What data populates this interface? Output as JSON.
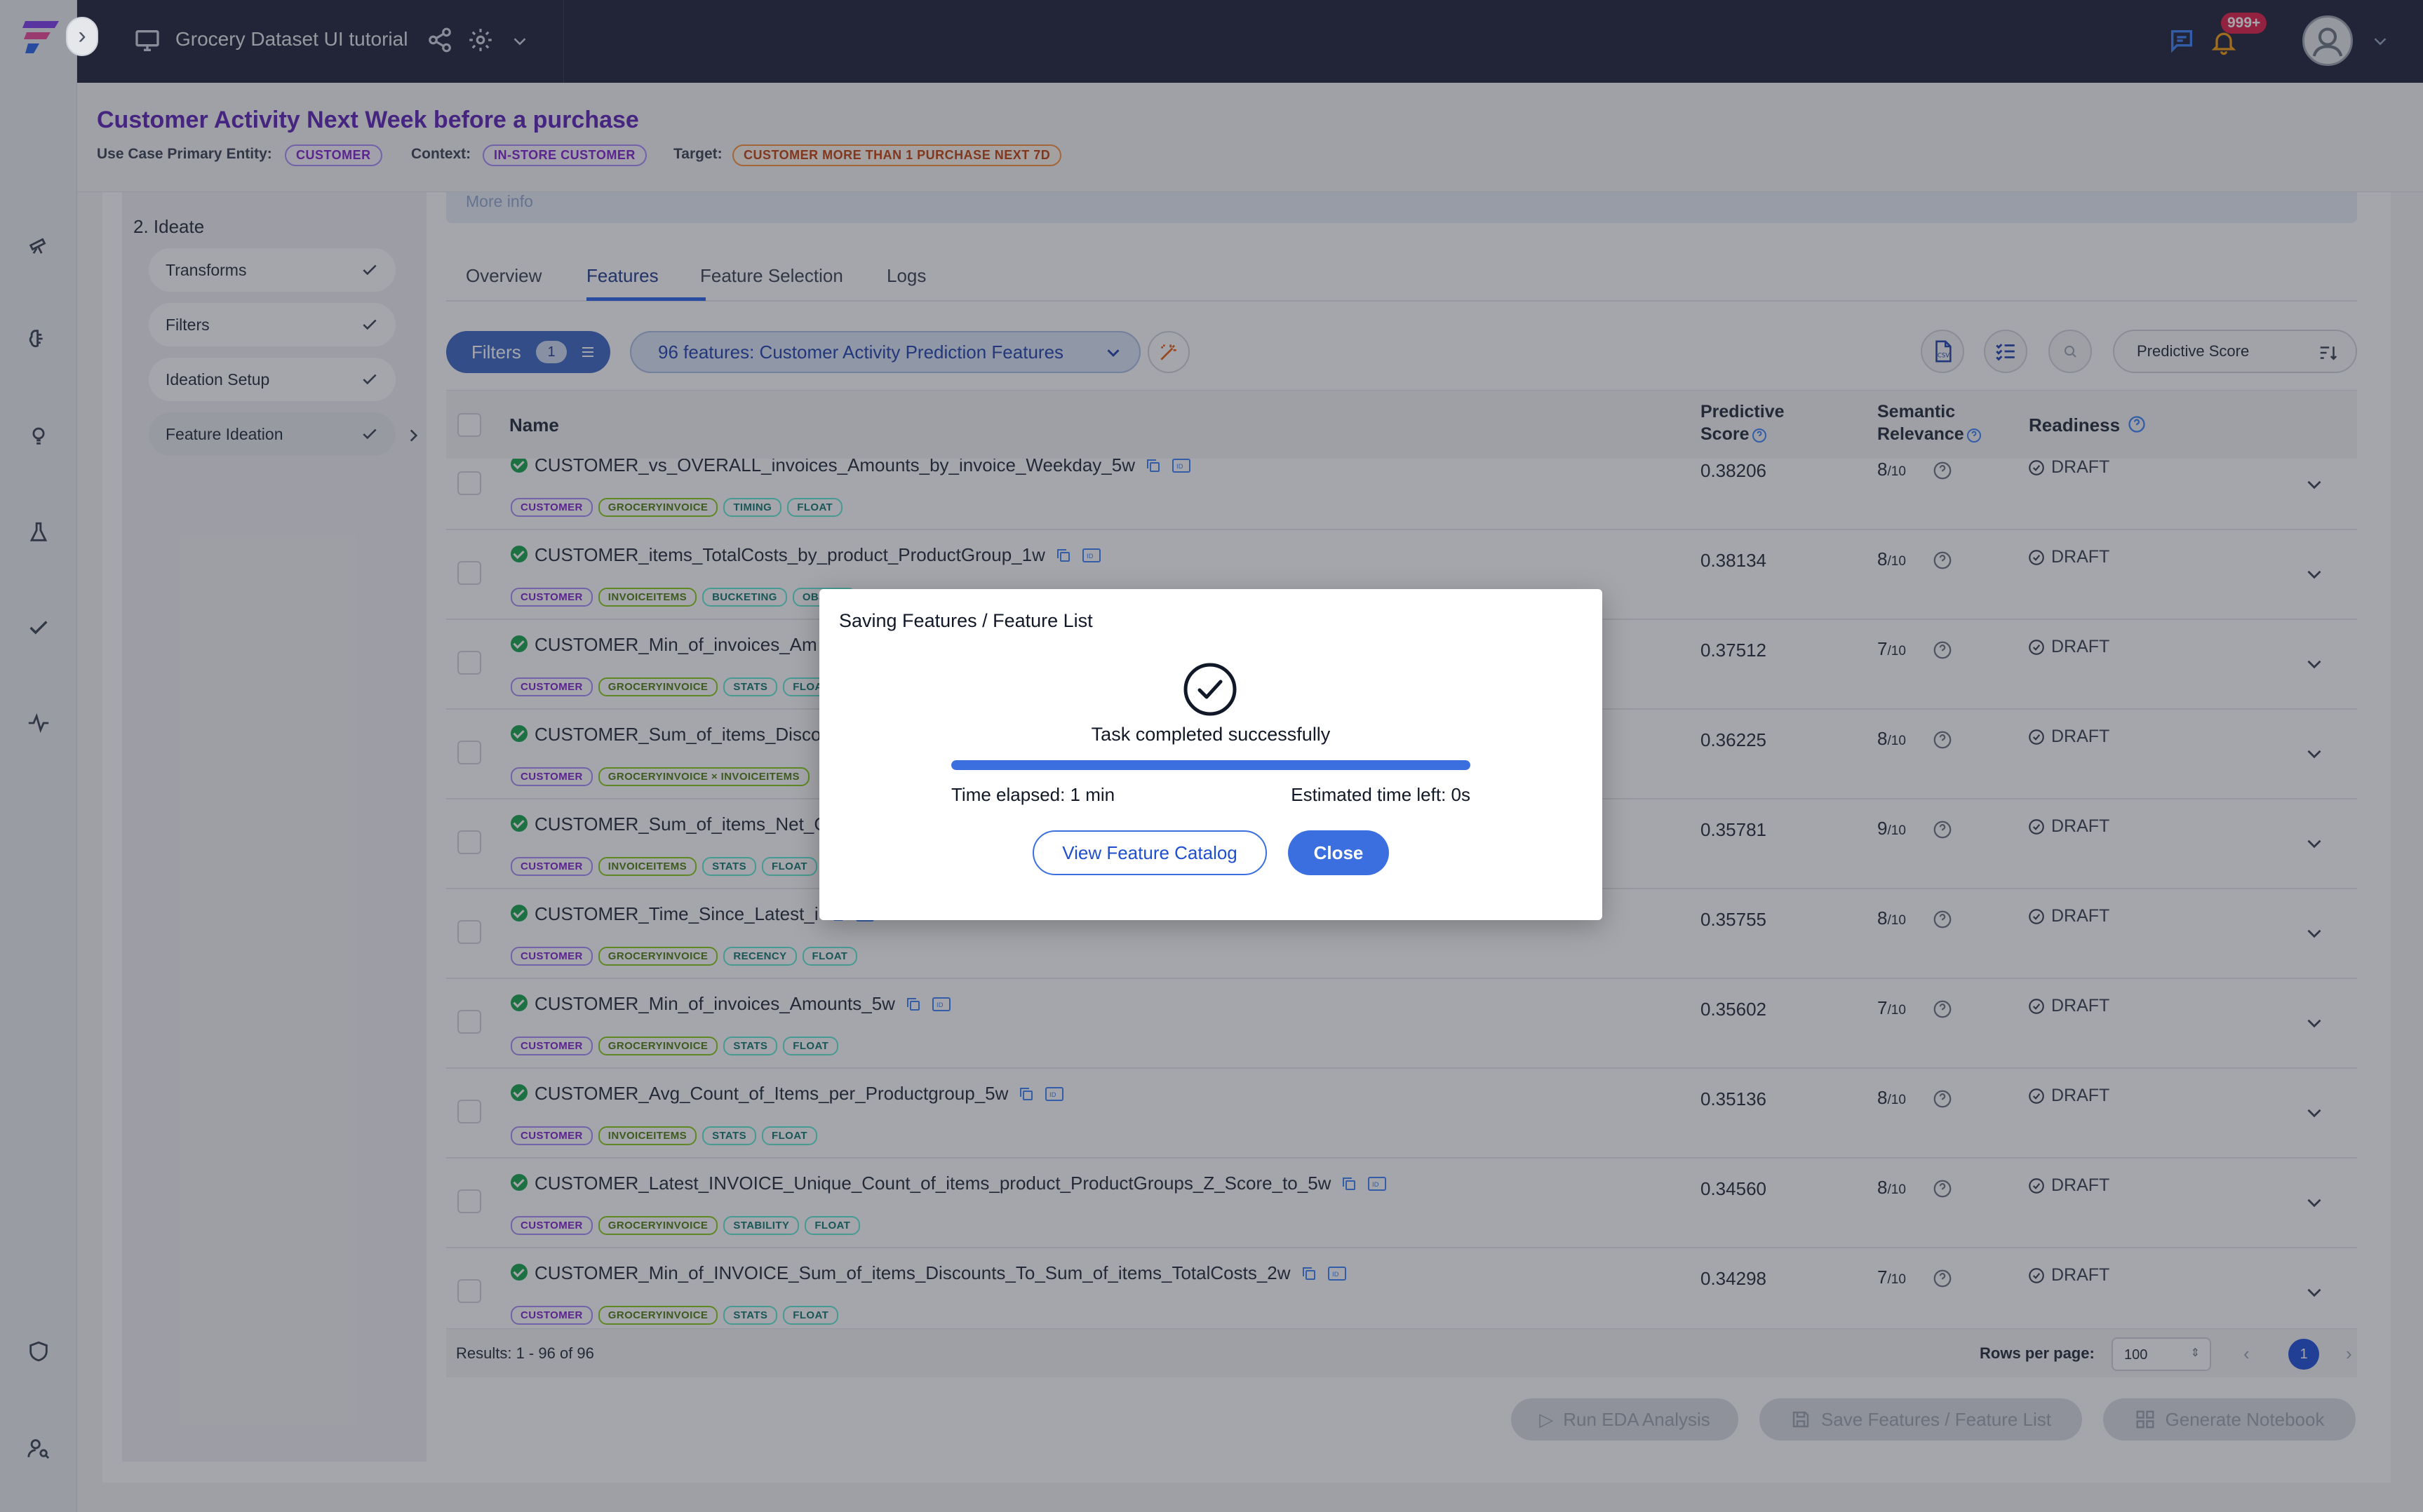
{
  "app": {
    "title": "Grocery Dataset UI tutorial",
    "notification_count": "999+"
  },
  "header": {
    "title": "Customer Activity Next Week before a purchase",
    "entity_label": "Use Case Primary Entity:",
    "entity_value": "CUSTOMER",
    "context_label": "Context:",
    "context_value": "IN-STORE CUSTOMER",
    "target_label": "Target:",
    "target_value": "CUSTOMER MORE THAN 1 PURCHASE NEXT 7D"
  },
  "stepper": {
    "section": "2. Ideate",
    "more_info": "More info",
    "items": [
      {
        "label": "Transforms"
      },
      {
        "label": "Filters"
      },
      {
        "label": "Ideation Setup"
      },
      {
        "label": "Feature Ideation"
      }
    ]
  },
  "tabs": [
    "Overview",
    "Features",
    "Feature Selection",
    "Logs"
  ],
  "toolbar": {
    "filters_label": "Filters",
    "filters_count": "1",
    "feature_list_label": "96 features: Customer Activity Prediction Features",
    "sort_label": "Predictive Score"
  },
  "table": {
    "col_name": "Name",
    "col_score_1": "Predictive",
    "col_score_2": "Score",
    "col_rel_1": "Semantic",
    "col_rel_2": "Relevance",
    "col_ready": "Readiness",
    "rows": [
      {
        "name": "CUSTOMER_vs_OVERALL_invoices_Amounts_by_invoice_Weekday_5w",
        "tags": [
          "CUSTOMER",
          "GROCERYINVOICE",
          "TIMING",
          "FLOAT"
        ],
        "score": "0.38206",
        "rel": "8",
        "ready": "DRAFT"
      },
      {
        "name": "CUSTOMER_items_TotalCosts_by_product_ProductGroup_1w",
        "tags": [
          "CUSTOMER",
          "INVOICEITEMS",
          "BUCKETING",
          "OBJECT"
        ],
        "score": "0.38134",
        "rel": "8",
        "ready": "DRAFT"
      },
      {
        "name": "CUSTOMER_Min_of_invoices_Am",
        "tags": [
          "CUSTOMER",
          "GROCERYINVOICE",
          "STATS",
          "FLOAT"
        ],
        "score": "0.37512",
        "rel": "7",
        "ready": "DRAFT"
      },
      {
        "name": "CUSTOMER_Sum_of_items_Disco",
        "tags": [
          "CUSTOMER",
          "GROCERYINVOICE × INVOICEITEMS"
        ],
        "score": "0.36225",
        "rel": "8",
        "ready": "DRAFT"
      },
      {
        "name": "CUSTOMER_Sum_of_items_Net_C",
        "tags": [
          "CUSTOMER",
          "INVOICEITEMS",
          "STATS",
          "FLOAT"
        ],
        "score": "0.35781",
        "rel": "9",
        "ready": "DRAFT"
      },
      {
        "name": "CUSTOMER_Time_Since_Latest_i",
        "tags": [
          "CUSTOMER",
          "GROCERYINVOICE",
          "RECENCY",
          "FLOAT"
        ],
        "score": "0.35755",
        "rel": "8",
        "ready": "DRAFT"
      },
      {
        "name": "CUSTOMER_Min_of_invoices_Amounts_5w",
        "tags": [
          "CUSTOMER",
          "GROCERYINVOICE",
          "STATS",
          "FLOAT"
        ],
        "score": "0.35602",
        "rel": "7",
        "ready": "DRAFT"
      },
      {
        "name": "CUSTOMER_Avg_Count_of_Items_per_Productgroup_5w",
        "tags": [
          "CUSTOMER",
          "INVOICEITEMS",
          "STATS",
          "FLOAT"
        ],
        "score": "0.35136",
        "rel": "8",
        "ready": "DRAFT"
      },
      {
        "name": "CUSTOMER_Latest_INVOICE_Unique_Count_of_items_product_ProductGroups_Z_Score_to_5w",
        "tags": [
          "CUSTOMER",
          "GROCERYINVOICE",
          "STABILITY",
          "FLOAT"
        ],
        "score": "0.34560",
        "rel": "8",
        "ready": "DRAFT"
      },
      {
        "name": "CUSTOMER_Min_of_INVOICE_Sum_of_items_Discounts_To_Sum_of_items_TotalCosts_2w",
        "tags": [
          "CUSTOMER",
          "GROCERYINVOICE",
          "STATS",
          "FLOAT"
        ],
        "score": "0.34298",
        "rel": "7",
        "ready": "DRAFT"
      }
    ],
    "rel_denominator": "/10"
  },
  "footer": {
    "results": "Results: 1 - 96 of 96",
    "rows_per_page_label": "Rows per page:",
    "rows_per_page_value": "100",
    "current_page": "1"
  },
  "actions": {
    "run_eda": "Run EDA Analysis",
    "save_features": "Save Features / Feature List",
    "generate_notebook": "Generate Notebook"
  },
  "modal": {
    "title": "Saving Features / Feature List",
    "status": "Task completed successfully",
    "progress": 1.0,
    "elapsed": "Time elapsed: 1 min",
    "time_left": "Estimated time left: 0s",
    "view_catalog": "View Feature Catalog",
    "close": "Close"
  },
  "colors": {
    "topbar": "#1c2237",
    "accent": "#3b6fe0",
    "title_purple": "#5b21b6",
    "success": "#16a34a"
  }
}
